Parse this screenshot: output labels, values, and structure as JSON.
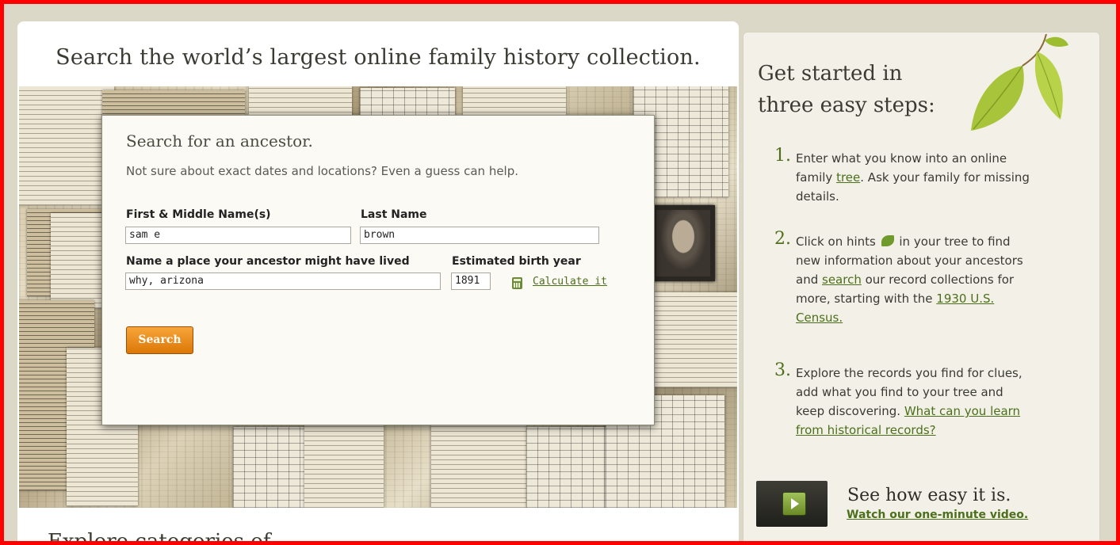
{
  "main": {
    "headline": "Search the world’s largest online family history collection.",
    "explore_heading": "Explore categories of"
  },
  "search_form": {
    "title": "Search for an ancestor.",
    "subtitle": "Not sure about exact dates and locations? Even a guess can help.",
    "first_name_label": "First & Middle Name(s)",
    "first_name_value": "sam e",
    "last_name_label": "Last Name",
    "last_name_value": "brown",
    "place_label": "Name a place your ancestor might have lived",
    "place_value": "why, arizona",
    "birth_year_label": "Estimated birth year",
    "birth_year_value": "1891",
    "calculate_link": "Calculate it",
    "search_button": "Search",
    "button_color": "#e8860f"
  },
  "sidebar": {
    "title": "Get started in three easy steps:",
    "steps": [
      {
        "num": "1.",
        "pre": "Enter what you know into an online family ",
        "link1": "tree",
        "post": ". Ask your family for missing details."
      },
      {
        "num": "2.",
        "pre": "Click on hints ",
        "mid": " in your tree to find new information about your ancestors and ",
        "link1": "search",
        "mid2": " our record collections for more, starting with the ",
        "link2": "1930 U.S. Census."
      },
      {
        "num": "3.",
        "pre": "Explore the records you find for clues, add what you find to your tree and keep discovering. ",
        "link1": "What can you learn from historical records?"
      }
    ],
    "video_title": "See how easy it is.",
    "video_link": "Watch our one-minute video.",
    "accent_color": "#4c6f1c"
  }
}
